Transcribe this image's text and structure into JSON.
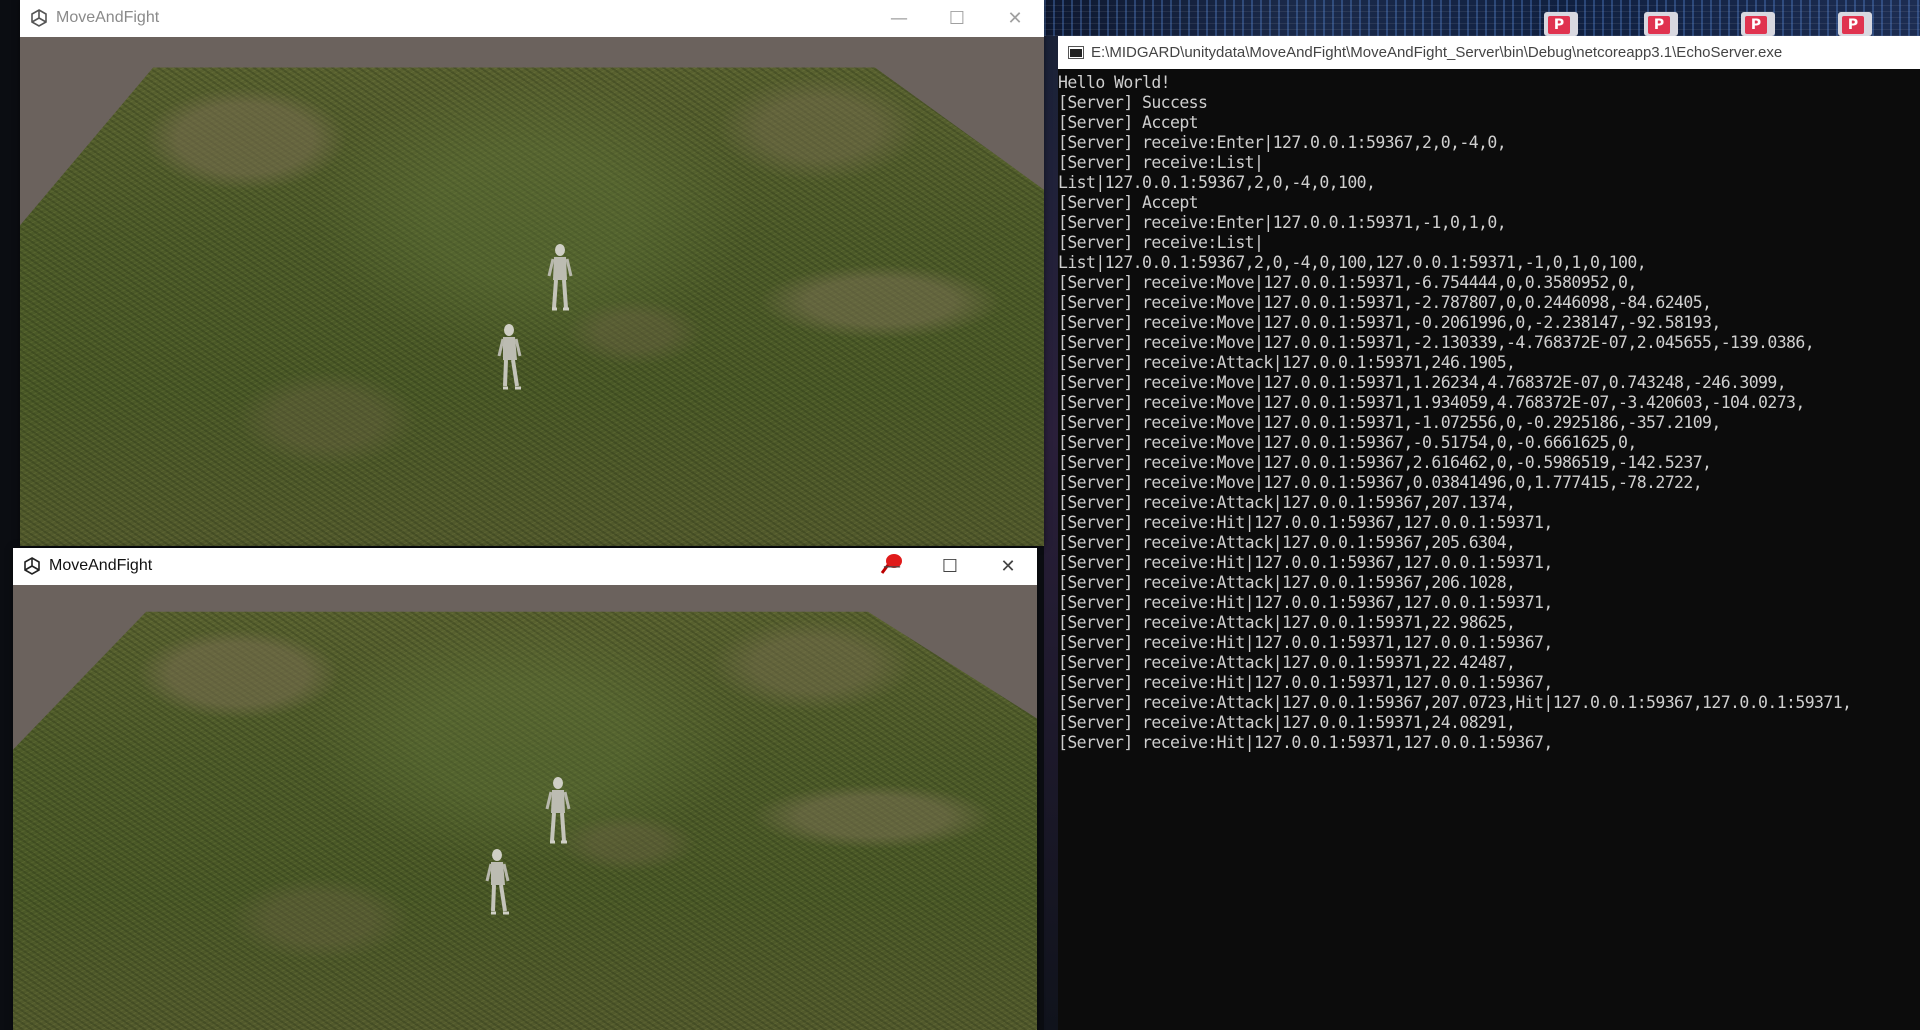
{
  "windows": {
    "top": {
      "title": "MoveAndFight",
      "state": "inactive"
    },
    "bottom": {
      "title": "MoveAndFight",
      "state": "active"
    }
  },
  "console": {
    "title": "E:\\MIDGARD\\unitydata\\MoveAndFight\\MoveAndFight_Server\\bin\\Debug\\netcoreapp3.1\\EchoServer.exe",
    "lines": [
      "Hello World!",
      "[Server] Success",
      "[Server] Accept",
      "[Server] receive:Enter|127.0.0.1:59367,2,0,-4,0,",
      "[Server] receive:List|",
      "List|127.0.0.1:59367,2,0,-4,0,100,",
      "[Server] Accept",
      "[Server] receive:Enter|127.0.0.1:59371,-1,0,1,0,",
      "[Server] receive:List|",
      "List|127.0.0.1:59367,2,0,-4,0,100,127.0.0.1:59371,-1,0,1,0,100,",
      "[Server] receive:Move|127.0.0.1:59371,-6.754444,0,0.3580952,0,",
      "[Server] receive:Move|127.0.0.1:59371,-2.787807,0,0.2446098,-84.62405,",
      "[Server] receive:Move|127.0.0.1:59371,-0.2061996,0,-2.238147,-92.58193,",
      "[Server] receive:Move|127.0.0.1:59371,-2.130339,-4.768372E-07,2.045655,-139.0386,",
      "[Server] receive:Attack|127.0.0.1:59371,246.1905,",
      "[Server] receive:Move|127.0.0.1:59371,1.26234,4.768372E-07,0.743248,-246.3099,",
      "[Server] receive:Move|127.0.0.1:59371,1.934059,4.768372E-07,-3.420603,-104.0273,",
      "[Server] receive:Move|127.0.0.1:59371,-1.072556,0,-0.2925186,-357.2109,",
      "[Server] receive:Move|127.0.0.1:59367,-0.51754,0,-0.6661625,0,",
      "[Server] receive:Move|127.0.0.1:59367,2.616462,0,-0.5986519,-142.5237,",
      "[Server] receive:Move|127.0.0.1:59367,0.03841496,0,1.777415,-78.2722,",
      "[Server] receive:Attack|127.0.0.1:59367,207.1374,",
      "[Server] receive:Hit|127.0.0.1:59367,127.0.0.1:59371,",
      "[Server] receive:Attack|127.0.0.1:59367,205.6304,",
      "[Server] receive:Hit|127.0.0.1:59367,127.0.0.1:59371,",
      "[Server] receive:Attack|127.0.0.1:59367,206.1028,",
      "[Server] receive:Hit|127.0.0.1:59367,127.0.0.1:59371,",
      "[Server] receive:Attack|127.0.0.1:59371,22.98625,",
      "[Server] receive:Hit|127.0.0.1:59371,127.0.0.1:59367,",
      "[Server] receive:Attack|127.0.0.1:59371,22.42487,",
      "[Server] receive:Hit|127.0.0.1:59371,127.0.0.1:59367,",
      "[Server] receive:Attack|127.0.0.1:59367,207.0723,Hit|127.0.0.1:59367,127.0.0.1:59371,",
      "[Server] receive:Attack|127.0.0.1:59371,24.08291,",
      "[Server] receive:Hit|127.0.0.1:59371,127.0.0.1:59367,"
    ]
  },
  "desktop": {
    "shortcut_badge": "P"
  },
  "icons": {
    "app": "unity-icon",
    "minimize": "minimize-icon",
    "maximize": "maximize-icon",
    "close": "close-icon",
    "console": "console-icon",
    "cursor": "red-pin-cursor-icon"
  },
  "colors": {
    "console_bg": "#0c0c0c",
    "console_text": "#cfcfcf",
    "sky": "#6b625d",
    "grass": "#4c5a28"
  }
}
